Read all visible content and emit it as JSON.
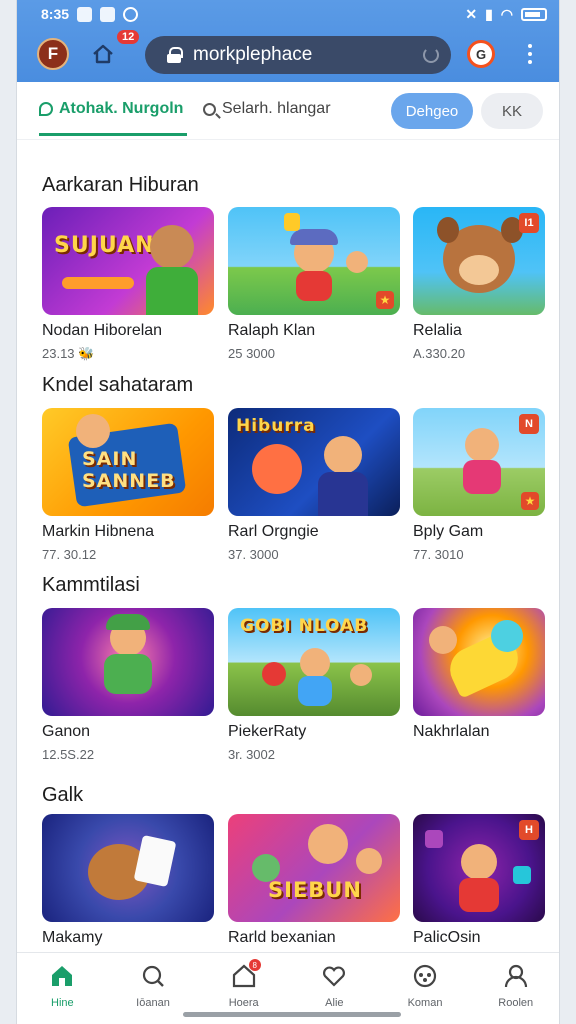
{
  "status_bar": {
    "time": "8:35"
  },
  "browser": {
    "app_logo_letter": "F",
    "notification_count": "12",
    "url": "morkplephace",
    "tab_count": "G"
  },
  "filter_bar": {
    "active_tab": "Atohak. Nurgoln",
    "search_tab": "Selarh. hlangar",
    "primary_pill": "Dehgeo",
    "secondary_pill": "KK"
  },
  "sections": [
    {
      "title": "Aarkaran Hiburan",
      "items": [
        {
          "title": "Nodan Hiborelan",
          "meta": "23.13 🐝",
          "art": "SUJUAN",
          "badge": "",
          "star": false
        },
        {
          "title": "Ralaph Klan",
          "meta": "25 3000",
          "art": "",
          "badge": "",
          "star": true
        },
        {
          "title": "Relalia",
          "meta": "A.330.20",
          "art": "",
          "badge": "I1",
          "star": false
        }
      ]
    },
    {
      "title": "Kndel sahataram",
      "items": [
        {
          "title": "Markin Hibnena",
          "meta": "77. 30.12",
          "art": "SAIN SANNEB",
          "badge": "",
          "star": false
        },
        {
          "title": "Rarl Orgngie",
          "meta": "37. 3000",
          "art": "Hiburra",
          "badge": "",
          "star": false
        },
        {
          "title": "Bply Gam",
          "meta": "77. 3010",
          "art": "",
          "badge": "N",
          "star": true
        }
      ]
    },
    {
      "title": "Kammtilasi",
      "items": [
        {
          "title": "Ganon",
          "meta": "12.5S.22",
          "art": "",
          "badge": "",
          "star": false
        },
        {
          "title": "PiekerRaty",
          "meta": "3r. 3002",
          "art": "GOBI NLOAB",
          "badge": "",
          "star": false
        },
        {
          "title": "Nakhrlalan",
          "meta": "",
          "art": "",
          "badge": "",
          "star": false
        }
      ]
    },
    {
      "title": "Galk",
      "items": [
        {
          "title": "Makamy",
          "meta": "",
          "art": "",
          "badge": "",
          "star": false
        },
        {
          "title": "Rarld bexanian",
          "meta": "",
          "art": "SIEBUN",
          "badge": "",
          "star": false
        },
        {
          "title": "PalicOsin",
          "meta": "",
          "art": "",
          "badge": "H",
          "star": false
        }
      ]
    }
  ],
  "bottom_nav": [
    {
      "label": "Hine",
      "icon": "home-icon",
      "active": true
    },
    {
      "label": "Iōanan",
      "icon": "search-icon",
      "active": false
    },
    {
      "label": "Hoera",
      "icon": "store-icon",
      "active": false,
      "badge": "8"
    },
    {
      "label": "Alie",
      "icon": "heart-icon",
      "active": false
    },
    {
      "label": "Koman",
      "icon": "gamepad-icon",
      "active": false
    },
    {
      "label": "Roolen",
      "icon": "profile-icon",
      "active": false
    }
  ],
  "colors": {
    "accent_green": "#1a9e6a",
    "browser_blue": "#4a8ddf",
    "url_bar": "#3a4a68",
    "badge_red": "#e24a2a"
  }
}
